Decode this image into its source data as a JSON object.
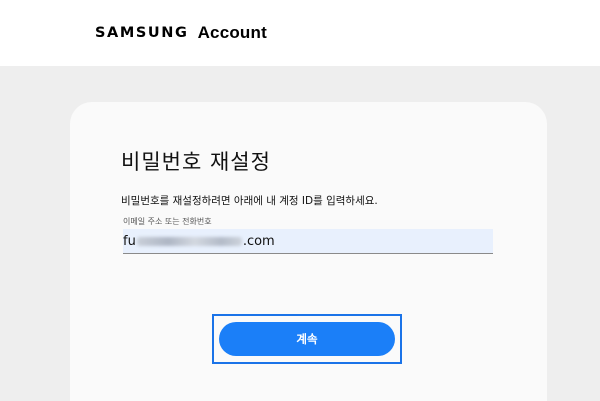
{
  "header": {
    "logo_text": "SAMSUNG",
    "account_text": "Account"
  },
  "card": {
    "title": "비밀번호 재설정",
    "description": "비밀번호를 재설정하려면 아래에 내 계정 ID를 입력하세요.",
    "field": {
      "label": "이메일 주소 또는 전화번호",
      "value_prefix": "fu",
      "value_suffix": ".com",
      "value_redacted": true
    },
    "continue_label": "계속"
  },
  "colors": {
    "accent": "#1b7ff8",
    "focus_ring": "#1a73e8",
    "field_background": "#e8f0fd",
    "page_background": "#eeeeee"
  }
}
